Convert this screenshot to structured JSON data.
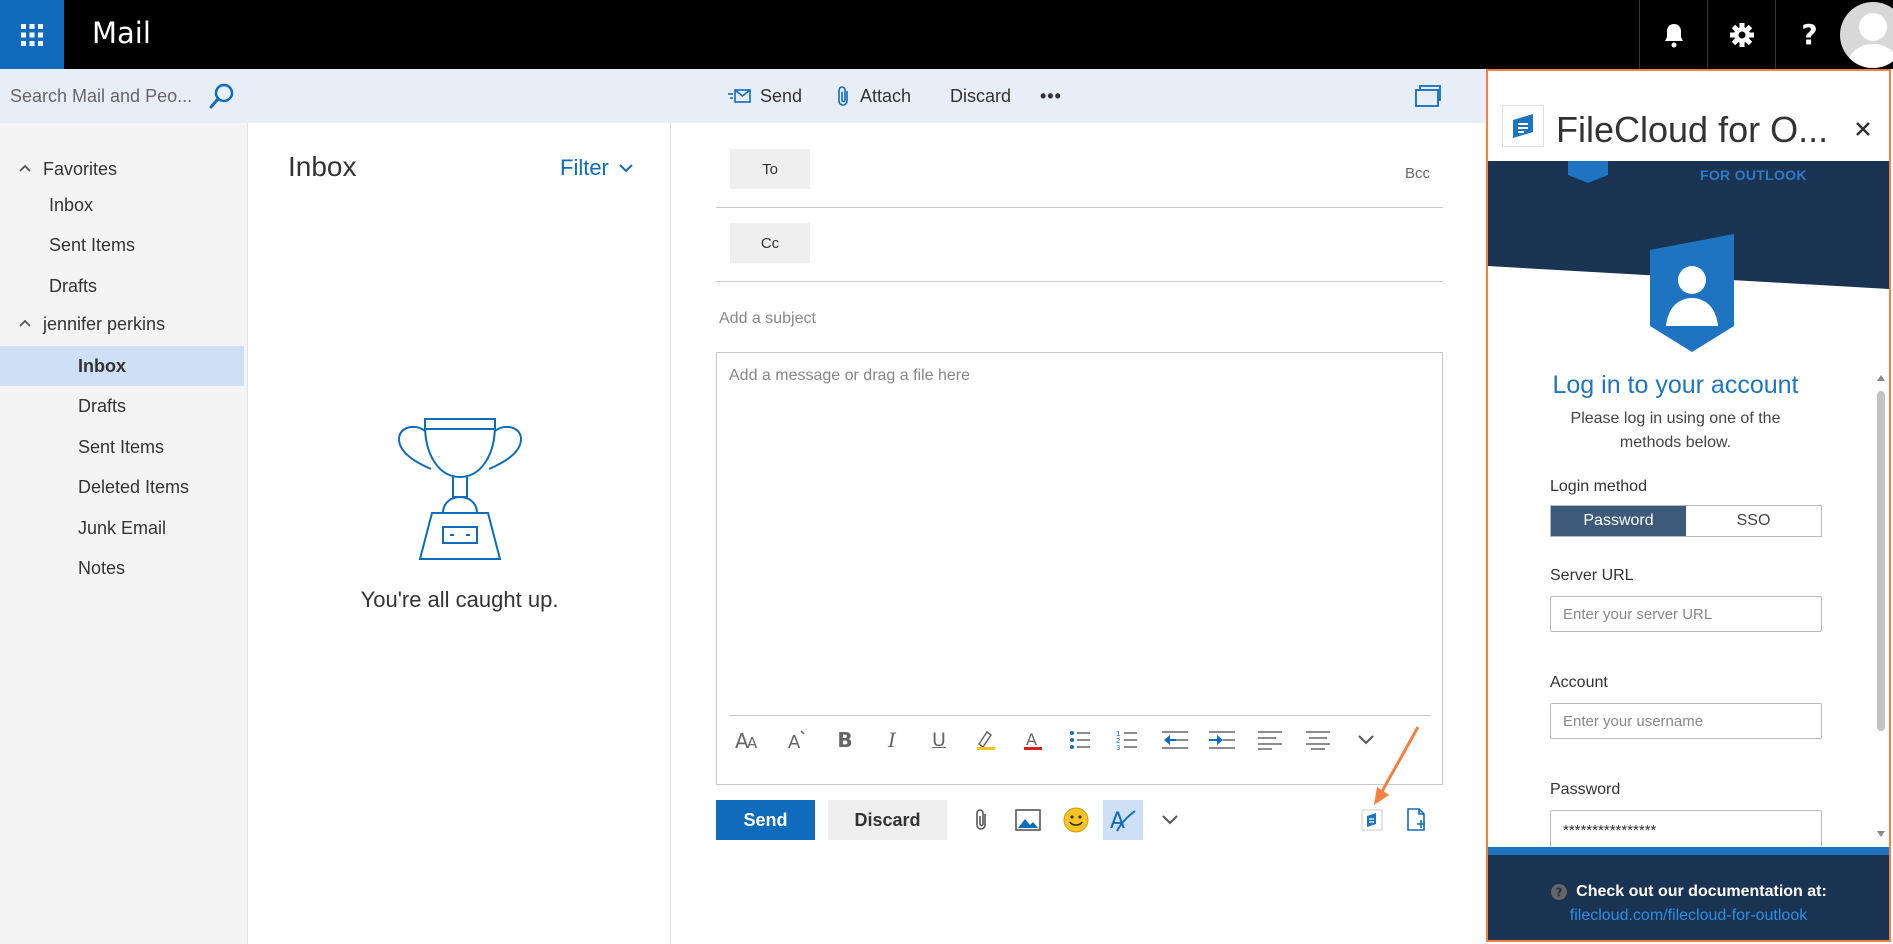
{
  "header": {
    "app_title": "Mail",
    "icons": [
      "waffle-icon",
      "bell-icon",
      "gear-icon",
      "help-icon",
      "avatar"
    ]
  },
  "search": {
    "placeholder": "Search Mail and Peo..."
  },
  "nav": {
    "favorites_label": "Favorites",
    "favorites": [
      "Inbox",
      "Sent Items",
      "Drafts"
    ],
    "account_label": "jennifer perkins",
    "account_items": [
      "Inbox",
      "Drafts",
      "Sent Items",
      "Deleted Items",
      "Junk Email",
      "Notes"
    ],
    "active_item": "Inbox"
  },
  "compose_toolbar": {
    "send": "Send",
    "attach": "Attach",
    "discard": "Discard",
    "more": "•••"
  },
  "inbox": {
    "title": "Inbox",
    "filter": "Filter",
    "empty_message": "You're all caught up."
  },
  "compose": {
    "to_label": "To",
    "cc_label": "Cc",
    "bcc_label": "Bcc",
    "subject_placeholder": "Add a subject",
    "body_placeholder": "Add a message or drag a file here",
    "send_button": "Send",
    "discard_button": "Discard"
  },
  "filecloud": {
    "title": "FileCloud for O...",
    "brand_tag": "FOR OUTLOOK",
    "login_title": "Log in to your account",
    "login_subtitle": "Please log in using one of the methods below.",
    "login_method_label": "Login method",
    "methods": [
      "Password",
      "SSO"
    ],
    "selected_method": "Password",
    "server_url_label": "Server URL",
    "server_url_placeholder": "Enter your server URL",
    "account_label": "Account",
    "account_placeholder": "Enter your username",
    "password_label": "Password",
    "password_value": "****************",
    "doc_text": "Check out our documentation at:",
    "doc_link": "filecloud.com/filecloud-for-outlook"
  },
  "colors": {
    "accent": "#0f6cbd",
    "nav_active": "#cde0f5",
    "filecloud_navy": "#1b3352",
    "filecloud_blue": "#1e74c0",
    "highlight_border": "#f58040"
  }
}
